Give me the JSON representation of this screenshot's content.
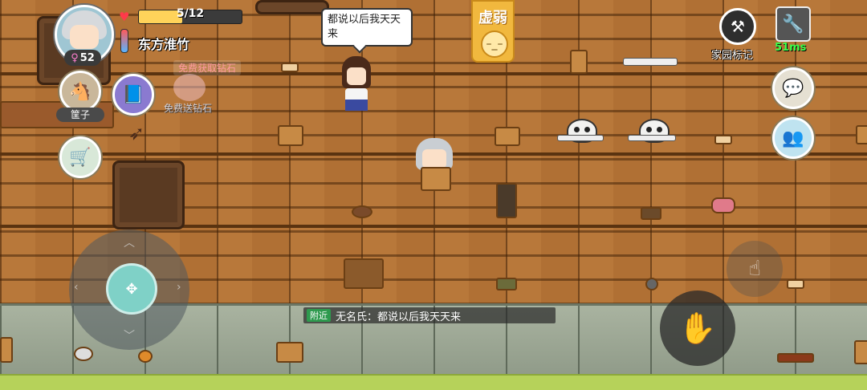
{
  "player": {
    "name": "东方淮竹",
    "level": "52",
    "gender_symbol": "♀",
    "hp_text": "5/12",
    "hp_fraction": 0.42
  },
  "promos": {
    "diamond_offer": "免费获取钻石",
    "free_diamond": "免费送钻石"
  },
  "pet": {
    "label": "筐子"
  },
  "status": {
    "label": "虚弱"
  },
  "speech_bubble": {
    "text": "都说以后我天天来"
  },
  "top_right": {
    "home_label": "家园标记",
    "ping": "51ms"
  },
  "chat": {
    "channel_tag": "附近",
    "message": "无名氏：都说以后我天天来"
  },
  "icons": {
    "heart": "heart-icon",
    "thermometer": "thermometer-icon",
    "home": "hammer-icon",
    "settings": "wrench-icon",
    "chat": "chat-icon",
    "friends": "friends-icon",
    "action": "hand-icon",
    "interact": "pickup-icon",
    "recipe": "book-icon",
    "craft": "bow-icon",
    "shop": "cart-icon"
  },
  "colors": {
    "hp_fill": "#ffd35a",
    "status": "#f1b83e",
    "ping": "#39ff4a",
    "chat_tag": "#2e9a4e"
  }
}
